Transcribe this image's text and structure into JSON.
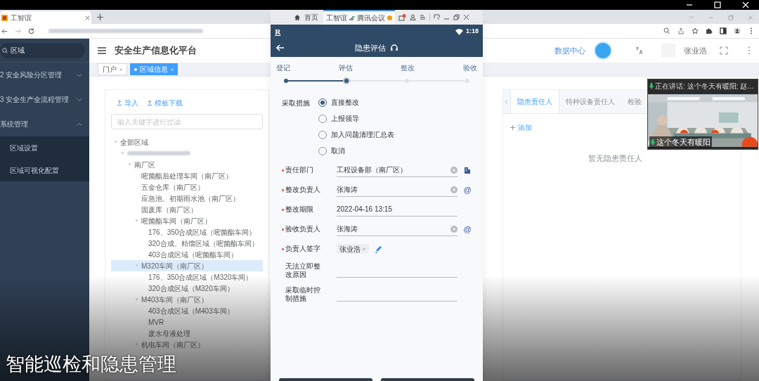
{
  "browser": {
    "tab_title": "工智谊"
  },
  "app": {
    "title": "安全生产信息化平台",
    "sidebar": {
      "search_value": "区域",
      "items": [
        {
          "label": "2 安全风险分区管理",
          "expanded": false
        },
        {
          "label": "3 安全生产全流程管理",
          "expanded": false
        },
        {
          "label": "系统管理",
          "expanded": true,
          "children": [
            {
              "label": "区域设置"
            },
            {
              "label": "区域可视化配置"
            }
          ]
        }
      ]
    },
    "header": {
      "data_center": "数据中心",
      "user": "张业浩"
    },
    "tags": [
      {
        "label": "门户",
        "selected": false
      },
      {
        "label": "区域信息",
        "selected": true
      }
    ],
    "tree_panel": {
      "actions": [
        "导入",
        "模板下载"
      ],
      "filter_placeholder": "输入关键字进行过滤",
      "tree": [
        {
          "label": "全部区域",
          "expanded": true,
          "selected": false,
          "children": [
            {
              "kind": "redacted",
              "expanded": true,
              "selected": false,
              "children": [
                {
                  "label": "南厂区",
                  "expanded": true,
                  "selected": false,
                  "children": [
                    {
                      "label": "嘧菌酯后处理车间（南厂区）",
                      "selected": false
                    },
                    {
                      "label": "五金仓库（南厂区）",
                      "selected": false
                    },
                    {
                      "label": "应急池、初期雨水池（南厂区）",
                      "selected": false
                    },
                    {
                      "label": "固废库（南厂区）",
                      "selected": false
                    },
                    {
                      "label": "嘧菌酯车间（南厂区）",
                      "expanded": true,
                      "selected": false,
                      "children": [
                        {
                          "label": "176、350合成区域（嘧菌酯车间）",
                          "selected": false
                        },
                        {
                          "label": "320合成、精馏区域（嘧菌酯车间）",
                          "selected": false
                        },
                        {
                          "label": "403合成区域（嘧菌酯车间）",
                          "selected": false
                        }
                      ]
                    },
                    {
                      "label": "M320车间（南厂区）",
                      "expanded": true,
                      "selected": true,
                      "children": [
                        {
                          "label": "176、350合成区域（M320车间）",
                          "selected": false
                        },
                        {
                          "label": "320合成区域（M320车间）",
                          "selected": false
                        }
                      ]
                    },
                    {
                      "label": "M403车间（南厂区）",
                      "expanded": true,
                      "selected": false,
                      "children": [
                        {
                          "label": "403合成区域（M403车间）",
                          "selected": false
                        },
                        {
                          "label": "MVR",
                          "selected": false
                        },
                        {
                          "label": "废水母液处理",
                          "selected": false
                        }
                      ]
                    },
                    {
                      "label": "机电车间（南厂区）",
                      "expanded": true,
                      "selected": false
                    }
                  ]
                }
              ]
            }
          ]
        }
      ]
    },
    "right_panel": {
      "tabs": [
        {
          "label": "隐患责任人",
          "selected": true
        },
        {
          "label": "特种设备责任人",
          "selected": false
        },
        {
          "label": "检验",
          "selected": false
        }
      ],
      "add": "添加",
      "empty": "暂无隐患责任人"
    }
  },
  "phone": {
    "titlebar": {
      "home": "首页",
      "tab": "工智谊",
      "meeting": "腾讯会议"
    },
    "status": {
      "logo": "R",
      "time": "1:18"
    },
    "title": "隐患评估",
    "steps": [
      {
        "label": "登记",
        "done": true,
        "selected": false
      },
      {
        "label": "评估",
        "done": true,
        "selected": true
      },
      {
        "label": "整改",
        "done": false,
        "selected": false
      },
      {
        "label": "验收",
        "done": false,
        "selected": false
      }
    ],
    "measure": {
      "label": "采取措施",
      "options": [
        {
          "label": "直接整改",
          "selected": true
        },
        {
          "label": "上报领导",
          "selected": false
        },
        {
          "label": "加入问题清理汇总表",
          "selected": false
        },
        {
          "label": "取消",
          "selected": false
        }
      ]
    },
    "fields": [
      {
        "kind": "text",
        "label": "责任部门",
        "required": true,
        "value": "工程设备部（南厂区）",
        "clearable": true,
        "action": {
          "kind": "icon"
        }
      },
      {
        "kind": "text",
        "label": "整改负责人",
        "required": true,
        "value": "张海涛",
        "clearable": true,
        "action": {
          "kind": "symbol",
          "text": "@"
        }
      },
      {
        "kind": "text",
        "label": "整改期限",
        "required": true,
        "value": "2022-04-16 13:15",
        "clearable": false
      },
      {
        "kind": "text",
        "label": "验收负责人",
        "required": true,
        "value": "张海涛",
        "clearable": true,
        "action": {
          "kind": "symbol",
          "text": "@"
        }
      },
      {
        "kind": "signature",
        "label": "负责人签字",
        "required": true,
        "value": "张业浩"
      },
      {
        "kind": "text",
        "label": "无法立即整改原因",
        "required": false,
        "clearable": false
      },
      {
        "kind": "text",
        "label": "采取临时控制措施",
        "required": false,
        "clearable": false
      }
    ]
  },
  "meeting_tile": {
    "speaking": "正在讲话: 这个冬天有暖阳; 赵…",
    "name": "这个冬天有暖阳"
  },
  "caption": "智能巡检和隐患管理"
}
